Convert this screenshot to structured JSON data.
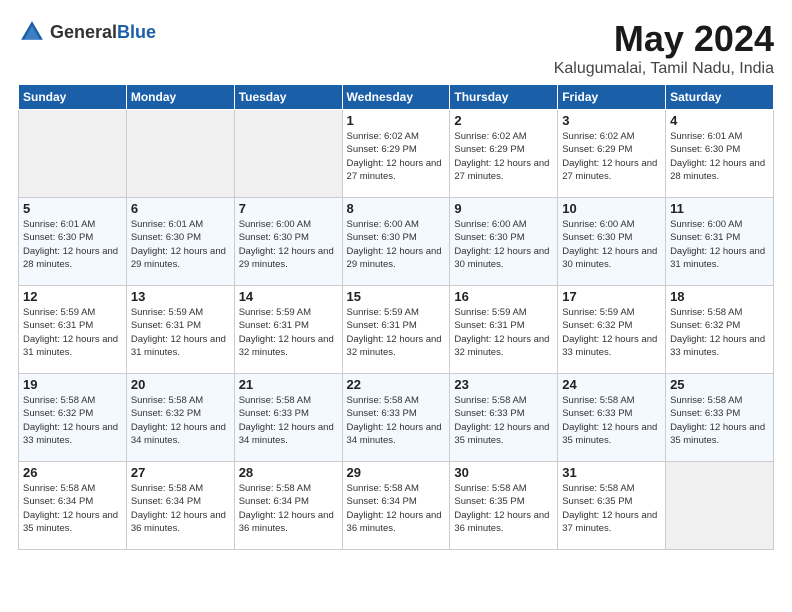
{
  "logo": {
    "general": "General",
    "blue": "Blue"
  },
  "title": "May 2024",
  "subtitle": "Kalugumalai, Tamil Nadu, India",
  "weekdays": [
    "Sunday",
    "Monday",
    "Tuesday",
    "Wednesday",
    "Thursday",
    "Friday",
    "Saturday"
  ],
  "weeks": [
    [
      {
        "day": "",
        "sunrise": "",
        "sunset": "",
        "daylight": ""
      },
      {
        "day": "",
        "sunrise": "",
        "sunset": "",
        "daylight": ""
      },
      {
        "day": "",
        "sunrise": "",
        "sunset": "",
        "daylight": ""
      },
      {
        "day": "1",
        "sunrise": "Sunrise: 6:02 AM",
        "sunset": "Sunset: 6:29 PM",
        "daylight": "Daylight: 12 hours and 27 minutes."
      },
      {
        "day": "2",
        "sunrise": "Sunrise: 6:02 AM",
        "sunset": "Sunset: 6:29 PM",
        "daylight": "Daylight: 12 hours and 27 minutes."
      },
      {
        "day": "3",
        "sunrise": "Sunrise: 6:02 AM",
        "sunset": "Sunset: 6:29 PM",
        "daylight": "Daylight: 12 hours and 27 minutes."
      },
      {
        "day": "4",
        "sunrise": "Sunrise: 6:01 AM",
        "sunset": "Sunset: 6:30 PM",
        "daylight": "Daylight: 12 hours and 28 minutes."
      }
    ],
    [
      {
        "day": "5",
        "sunrise": "Sunrise: 6:01 AM",
        "sunset": "Sunset: 6:30 PM",
        "daylight": "Daylight: 12 hours and 28 minutes."
      },
      {
        "day": "6",
        "sunrise": "Sunrise: 6:01 AM",
        "sunset": "Sunset: 6:30 PM",
        "daylight": "Daylight: 12 hours and 29 minutes."
      },
      {
        "day": "7",
        "sunrise": "Sunrise: 6:00 AM",
        "sunset": "Sunset: 6:30 PM",
        "daylight": "Daylight: 12 hours and 29 minutes."
      },
      {
        "day": "8",
        "sunrise": "Sunrise: 6:00 AM",
        "sunset": "Sunset: 6:30 PM",
        "daylight": "Daylight: 12 hours and 29 minutes."
      },
      {
        "day": "9",
        "sunrise": "Sunrise: 6:00 AM",
        "sunset": "Sunset: 6:30 PM",
        "daylight": "Daylight: 12 hours and 30 minutes."
      },
      {
        "day": "10",
        "sunrise": "Sunrise: 6:00 AM",
        "sunset": "Sunset: 6:30 PM",
        "daylight": "Daylight: 12 hours and 30 minutes."
      },
      {
        "day": "11",
        "sunrise": "Sunrise: 6:00 AM",
        "sunset": "Sunset: 6:31 PM",
        "daylight": "Daylight: 12 hours and 31 minutes."
      }
    ],
    [
      {
        "day": "12",
        "sunrise": "Sunrise: 5:59 AM",
        "sunset": "Sunset: 6:31 PM",
        "daylight": "Daylight: 12 hours and 31 minutes."
      },
      {
        "day": "13",
        "sunrise": "Sunrise: 5:59 AM",
        "sunset": "Sunset: 6:31 PM",
        "daylight": "Daylight: 12 hours and 31 minutes."
      },
      {
        "day": "14",
        "sunrise": "Sunrise: 5:59 AM",
        "sunset": "Sunset: 6:31 PM",
        "daylight": "Daylight: 12 hours and 32 minutes."
      },
      {
        "day": "15",
        "sunrise": "Sunrise: 5:59 AM",
        "sunset": "Sunset: 6:31 PM",
        "daylight": "Daylight: 12 hours and 32 minutes."
      },
      {
        "day": "16",
        "sunrise": "Sunrise: 5:59 AM",
        "sunset": "Sunset: 6:31 PM",
        "daylight": "Daylight: 12 hours and 32 minutes."
      },
      {
        "day": "17",
        "sunrise": "Sunrise: 5:59 AM",
        "sunset": "Sunset: 6:32 PM",
        "daylight": "Daylight: 12 hours and 33 minutes."
      },
      {
        "day": "18",
        "sunrise": "Sunrise: 5:58 AM",
        "sunset": "Sunset: 6:32 PM",
        "daylight": "Daylight: 12 hours and 33 minutes."
      }
    ],
    [
      {
        "day": "19",
        "sunrise": "Sunrise: 5:58 AM",
        "sunset": "Sunset: 6:32 PM",
        "daylight": "Daylight: 12 hours and 33 minutes."
      },
      {
        "day": "20",
        "sunrise": "Sunrise: 5:58 AM",
        "sunset": "Sunset: 6:32 PM",
        "daylight": "Daylight: 12 hours and 34 minutes."
      },
      {
        "day": "21",
        "sunrise": "Sunrise: 5:58 AM",
        "sunset": "Sunset: 6:33 PM",
        "daylight": "Daylight: 12 hours and 34 minutes."
      },
      {
        "day": "22",
        "sunrise": "Sunrise: 5:58 AM",
        "sunset": "Sunset: 6:33 PM",
        "daylight": "Daylight: 12 hours and 34 minutes."
      },
      {
        "day": "23",
        "sunrise": "Sunrise: 5:58 AM",
        "sunset": "Sunset: 6:33 PM",
        "daylight": "Daylight: 12 hours and 35 minutes."
      },
      {
        "day": "24",
        "sunrise": "Sunrise: 5:58 AM",
        "sunset": "Sunset: 6:33 PM",
        "daylight": "Daylight: 12 hours and 35 minutes."
      },
      {
        "day": "25",
        "sunrise": "Sunrise: 5:58 AM",
        "sunset": "Sunset: 6:33 PM",
        "daylight": "Daylight: 12 hours and 35 minutes."
      }
    ],
    [
      {
        "day": "26",
        "sunrise": "Sunrise: 5:58 AM",
        "sunset": "Sunset: 6:34 PM",
        "daylight": "Daylight: 12 hours and 35 minutes."
      },
      {
        "day": "27",
        "sunrise": "Sunrise: 5:58 AM",
        "sunset": "Sunset: 6:34 PM",
        "daylight": "Daylight: 12 hours and 36 minutes."
      },
      {
        "day": "28",
        "sunrise": "Sunrise: 5:58 AM",
        "sunset": "Sunset: 6:34 PM",
        "daylight": "Daylight: 12 hours and 36 minutes."
      },
      {
        "day": "29",
        "sunrise": "Sunrise: 5:58 AM",
        "sunset": "Sunset: 6:34 PM",
        "daylight": "Daylight: 12 hours and 36 minutes."
      },
      {
        "day": "30",
        "sunrise": "Sunrise: 5:58 AM",
        "sunset": "Sunset: 6:35 PM",
        "daylight": "Daylight: 12 hours and 36 minutes."
      },
      {
        "day": "31",
        "sunrise": "Sunrise: 5:58 AM",
        "sunset": "Sunset: 6:35 PM",
        "daylight": "Daylight: 12 hours and 37 minutes."
      },
      {
        "day": "",
        "sunrise": "",
        "sunset": "",
        "daylight": ""
      }
    ]
  ]
}
